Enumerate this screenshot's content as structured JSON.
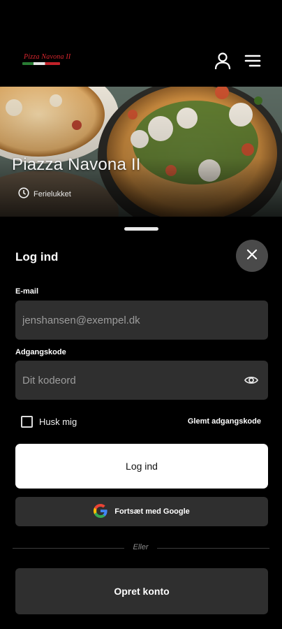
{
  "header": {
    "logo_text": "Pizza Navona II",
    "user_icon": "user-icon",
    "menu_icon": "hamburger-menu-icon"
  },
  "hero": {
    "restaurant_name": "Piazza Navona II",
    "status_text": "Ferielukket",
    "status_icon": "clock-icon"
  },
  "login_sheet": {
    "title": "Log ind",
    "close_icon": "close-icon",
    "email": {
      "label": "E-mail",
      "placeholder": "jenshansen@exempel.dk",
      "value": ""
    },
    "password": {
      "label": "Adgangskode",
      "placeholder": "Dit kodeord",
      "value": "",
      "toggle_icon": "eye-icon"
    },
    "remember_me_label": "Husk mig",
    "remember_me_checked": false,
    "forgot_password_label": "Glemt adgangskode",
    "login_button_label": "Log ind",
    "google_button_label": "Fortsæt med Google",
    "divider_text": "Eller",
    "create_account_label": "Opret konto"
  },
  "colors": {
    "background": "#000000",
    "field_background": "#2f2f2f",
    "close_button": "#4a4a4a",
    "primary_button": "#ffffff",
    "logo_red": "#d8262e"
  }
}
